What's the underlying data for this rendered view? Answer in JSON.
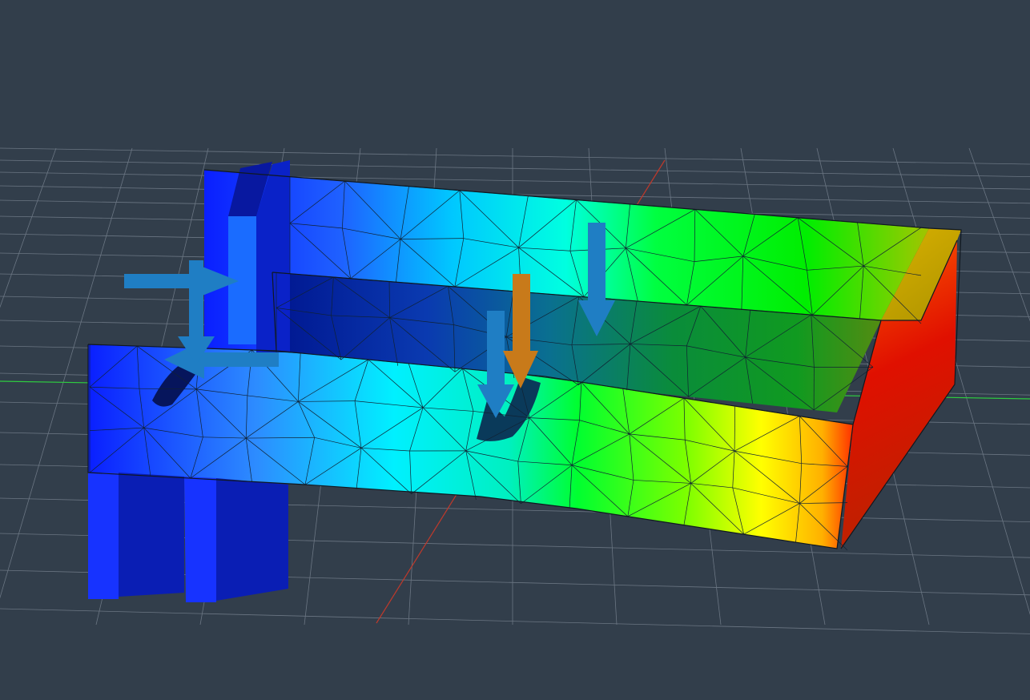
{
  "viewport": {
    "background": "#323e4b",
    "grid_color": "#6b7683",
    "x_axis_color": "#c0392b",
    "y_axis_color": "#2ecc40",
    "result_colormap": [
      "#0000ff",
      "#00ffff",
      "#00ff00",
      "#ffff00",
      "#ff0000"
    ],
    "constraint_arrow_color": "#1f7ec4",
    "load_arrow_color": "#c87a1a",
    "icons": {
      "constraint": "blue-arrow-icon",
      "load": "orange-arrow-icon"
    }
  }
}
